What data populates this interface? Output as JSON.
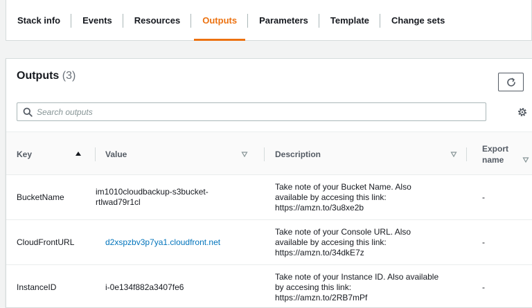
{
  "tabs": [
    {
      "label": "Stack info",
      "active": false
    },
    {
      "label": "Events",
      "active": false
    },
    {
      "label": "Resources",
      "active": false
    },
    {
      "label": "Outputs",
      "active": true
    },
    {
      "label": "Parameters",
      "active": false
    },
    {
      "label": "Template",
      "active": false
    },
    {
      "label": "Change sets",
      "active": false
    }
  ],
  "outputs": {
    "title": "Outputs",
    "count": "(3)",
    "search_placeholder": "Search outputs"
  },
  "table": {
    "headers": {
      "key": "Key",
      "value": "Value",
      "description": "Description",
      "export_line1": "Export",
      "export_line2": "name"
    },
    "rows": [
      {
        "key": "BucketName",
        "value_line1": "im1010cloudbackup-s3bucket-",
        "value_line2": "rtlwad79r1cl",
        "desc_line1": "Take note of your Bucket Name. Also",
        "desc_line2": "available by accesing this link:",
        "desc_line3": "https://amzn.to/3u8xe2b",
        "export": "-"
      },
      {
        "key": "CloudFrontURL",
        "value_link": "d2xspzbv3p7ya1.cloudfront.net",
        "desc_line1": "Take note of your Console URL. Also",
        "desc_line2": "available by accesing this link:",
        "desc_line3": "https://amzn.to/34dkE7z",
        "export": "-"
      },
      {
        "key": "InstanceID",
        "value_line1": "i-0e134f882a3407fe6",
        "desc_line1": "Take note of your Instance ID. Also available",
        "desc_line2": "by accesing this link:",
        "desc_line3": "https://amzn.to/2RB7mPf",
        "export": "-"
      }
    ]
  },
  "colors": {
    "active_tab": "#ec7211",
    "link": "#0073bb",
    "background": "#f2f3f3"
  },
  "icons": {
    "refresh": "refresh-icon",
    "search": "search-icon",
    "settings": "gear-icon",
    "sort_asc": "caret-up-icon",
    "sort_none": "caret-down-outline-icon"
  }
}
